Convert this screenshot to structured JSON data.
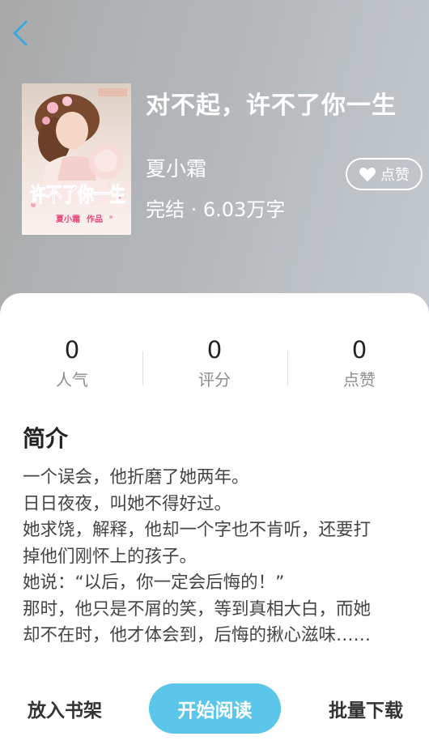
{
  "header": {
    "back_icon": "chevron-left-icon"
  },
  "book": {
    "title": "对不起，许不了你一生",
    "author": "夏小霜",
    "status": "完结 · 6.03万字",
    "cover": {
      "title_art": "许不了你一生",
      "author_art": "夏小霜",
      "author_suffix": "作品"
    }
  },
  "like_button": {
    "label": "点赞",
    "icon": "heart-icon"
  },
  "stats": [
    {
      "value": "0",
      "label": "人气"
    },
    {
      "value": "0",
      "label": "评分"
    },
    {
      "value": "0",
      "label": "点赞"
    }
  ],
  "synopsis": {
    "title": "简介",
    "lines": [
      "一个误会，他折磨了她两年。",
      "日日夜夜，叫她不得好过。",
      "她求饶，解释，他却一个字也不肯听，还要打",
      "掉他们刚怀上的孩子。",
      "她说：“以后，你一定会后悔的！”",
      "那时，他只是不屑的笑，等到真相大白，而她",
      "却不在时，他才体会到，后悔的揪心滋味……"
    ]
  },
  "actions": {
    "add_to_shelf": "放入书架",
    "start_reading": "开始阅读",
    "batch_download": "批量下载"
  },
  "colors": {
    "accent": "#5bc6ea",
    "back_icon": "#3aa8d8"
  }
}
